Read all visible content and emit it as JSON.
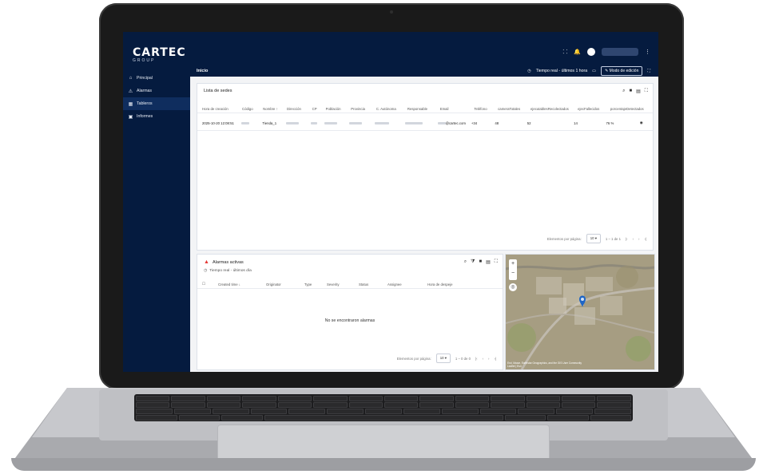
{
  "app": {
    "brand": "CARTEC",
    "brand_sub": "GROUP",
    "sidebar": {
      "items": [
        {
          "label": "Principal",
          "icon": "home-icon"
        },
        {
          "label": "Alarmas",
          "icon": "warning-icon"
        },
        {
          "label": "Tableros",
          "icon": "dashboard-icon"
        },
        {
          "label": "Informes",
          "icon": "report-icon"
        }
      ],
      "active_index": 2
    },
    "header": {
      "breadcrumb": "Inicio",
      "realtime_label": "Tiempo real - últimos 1 hora",
      "edit_mode_label": "Modo de edición"
    },
    "sedes": {
      "title": "Lista de sedes",
      "columns": [
        "Hora de creación",
        "Código",
        "Nombre ↑",
        "Dirección",
        "CP",
        "Población",
        "Provincia",
        "C. Autónoma",
        "Responsable",
        "Email",
        "Teléfono",
        "cameraTotales",
        "ejecutablesRecolectados",
        "ejecFallecidos",
        "porcentajeDetectados"
      ],
      "row": {
        "created": "2025-10-20 12:08:51",
        "name": "Tienda_1",
        "email_suffix": "@cartec.com",
        "phone_prefix": "+34",
        "cameras": "48",
        "recolectados": "52",
        "fallecidos": "14",
        "porcentaje": "76 %"
      },
      "pager": {
        "label": "Elementos por página:",
        "size": "10",
        "range": "1 – 1 de 1"
      }
    },
    "alarms": {
      "title": "Alarmas activas",
      "subtitle": "Tiempo real - últimos día",
      "columns": [
        "Created time ↓",
        "Originator",
        "Type",
        "Severity",
        "Status",
        "Assignee",
        "Hora de despeje"
      ],
      "empty": "No se encontraron alarmas",
      "pager": {
        "label": "Elementos por página:",
        "size": "10",
        "range": "1 – 0 de 0"
      }
    },
    "map": {
      "attribution": "Esri, Maxar, Earthstar Geographics, and the GIS User Community",
      "attribution2": "Leaflet | Esri"
    },
    "colors": {
      "sidebar": "#051b3f",
      "accent": "#1f66c6",
      "alert": "#e53935"
    }
  }
}
